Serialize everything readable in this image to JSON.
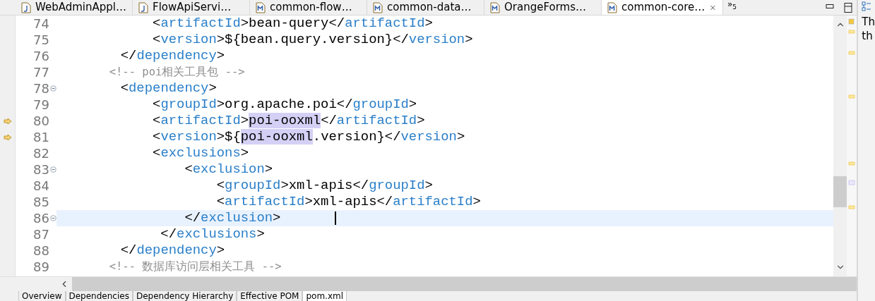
{
  "editor_tabs": [
    {
      "label": "WebAdminAppl…",
      "kind": "java",
      "selected": false
    },
    {
      "label": "FlowApiServi…",
      "kind": "java",
      "selected": false
    },
    {
      "label": "common-flow…",
      "kind": "maven",
      "selected": false
    },
    {
      "label": "common-data…",
      "kind": "maven",
      "selected": false
    },
    {
      "label": "OrangeForms…",
      "kind": "maven",
      "selected": false
    },
    {
      "label": "common-core…",
      "kind": "maven",
      "selected": true
    }
  ],
  "overflow": {
    "symbol": "»",
    "count": "5"
  },
  "code_lines": [
    {
      "number": "74",
      "fold": false,
      "marker": false,
      "current": false,
      "segs": [
        {
          "kind": "punct",
          "text": "            <"
        },
        {
          "kind": "name",
          "text": "artifactId"
        },
        {
          "kind": "punct",
          "text": ">"
        },
        {
          "kind": "text",
          "text": "bean-query",
          "highlighted": false
        },
        {
          "kind": "punct",
          "text": "</"
        },
        {
          "kind": "name",
          "text": "artifactId"
        },
        {
          "kind": "punct",
          "text": ">"
        }
      ]
    },
    {
      "number": "75",
      "fold": false,
      "marker": false,
      "current": false,
      "segs": [
        {
          "kind": "punct",
          "text": "            <"
        },
        {
          "kind": "name",
          "text": "version"
        },
        {
          "kind": "punct",
          "text": ">"
        },
        {
          "kind": "text",
          "text": "${bean.query.version}",
          "highlighted": false
        },
        {
          "kind": "punct",
          "text": "</"
        },
        {
          "kind": "name",
          "text": "version"
        },
        {
          "kind": "punct",
          "text": ">"
        }
      ]
    },
    {
      "number": "76",
      "fold": false,
      "marker": false,
      "current": false,
      "segs": [
        {
          "kind": "punct",
          "text": "        </"
        },
        {
          "kind": "name",
          "text": "dependency"
        },
        {
          "kind": "punct",
          "text": ">"
        }
      ]
    },
    {
      "number": "77",
      "fold": false,
      "marker": false,
      "current": false,
      "segs": [
        {
          "kind": "comment",
          "text": "        <!-- poi相关工具包 -->"
        }
      ]
    },
    {
      "number": "78",
      "fold": true,
      "marker": false,
      "current": false,
      "segs": [
        {
          "kind": "punct",
          "text": "        <"
        },
        {
          "kind": "name",
          "text": "dependency"
        },
        {
          "kind": "punct",
          "text": ">"
        }
      ]
    },
    {
      "number": "79",
      "fold": false,
      "marker": false,
      "current": false,
      "segs": [
        {
          "kind": "punct",
          "text": "            <"
        },
        {
          "kind": "name",
          "text": "groupId"
        },
        {
          "kind": "punct",
          "text": ">"
        },
        {
          "kind": "text",
          "text": "org.apache.poi",
          "highlighted": false
        },
        {
          "kind": "punct",
          "text": "</"
        },
        {
          "kind": "name",
          "text": "groupId"
        },
        {
          "kind": "punct",
          "text": ">"
        }
      ]
    },
    {
      "number": "80",
      "fold": false,
      "marker": true,
      "current": false,
      "segs": [
        {
          "kind": "punct",
          "text": "            <"
        },
        {
          "kind": "name",
          "text": "artifactId"
        },
        {
          "kind": "punct",
          "text": ">"
        },
        {
          "kind": "text",
          "text": "poi-ooxml",
          "highlighted": true
        },
        {
          "kind": "punct",
          "text": "</"
        },
        {
          "kind": "name",
          "text": "artifactId"
        },
        {
          "kind": "punct",
          "text": ">"
        }
      ]
    },
    {
      "number": "81",
      "fold": false,
      "marker": true,
      "current": false,
      "segs": [
        {
          "kind": "punct",
          "text": "            <"
        },
        {
          "kind": "name",
          "text": "version"
        },
        {
          "kind": "punct",
          "text": ">"
        },
        {
          "kind": "text",
          "text": "${",
          "highlighted": false
        },
        {
          "kind": "text",
          "text": "poi-ooxml",
          "highlighted": true
        },
        {
          "kind": "text",
          "text": ".version}",
          "highlighted": false
        },
        {
          "kind": "punct",
          "text": "</"
        },
        {
          "kind": "name",
          "text": "version"
        },
        {
          "kind": "punct",
          "text": ">"
        }
      ]
    },
    {
      "number": "82",
      "fold": false,
      "marker": false,
      "current": false,
      "segs": [
        {
          "kind": "punct",
          "text": "            <"
        },
        {
          "kind": "name",
          "text": "exclusions"
        },
        {
          "kind": "punct",
          "text": ">"
        }
      ]
    },
    {
      "number": "83",
      "fold": true,
      "marker": false,
      "current": false,
      "segs": [
        {
          "kind": "punct",
          "text": "                <"
        },
        {
          "kind": "name",
          "text": "exclusion"
        },
        {
          "kind": "punct",
          "text": ">"
        }
      ]
    },
    {
      "number": "84",
      "fold": false,
      "marker": false,
      "current": false,
      "segs": [
        {
          "kind": "punct",
          "text": "                    <"
        },
        {
          "kind": "name",
          "text": "groupId"
        },
        {
          "kind": "punct",
          "text": ">"
        },
        {
          "kind": "text",
          "text": "xml-apis",
          "highlighted": false
        },
        {
          "kind": "punct",
          "text": "</"
        },
        {
          "kind": "name",
          "text": "groupId"
        },
        {
          "kind": "punct",
          "text": ">"
        }
      ]
    },
    {
      "number": "85",
      "fold": false,
      "marker": false,
      "current": false,
      "segs": [
        {
          "kind": "punct",
          "text": "                    <"
        },
        {
          "kind": "name",
          "text": "artifactId"
        },
        {
          "kind": "punct",
          "text": ">"
        },
        {
          "kind": "text",
          "text": "xml-apis",
          "highlighted": false
        },
        {
          "kind": "punct",
          "text": "</"
        },
        {
          "kind": "name",
          "text": "artifactId"
        },
        {
          "kind": "punct",
          "text": ">"
        }
      ]
    },
    {
      "number": "86",
      "fold": true,
      "marker": false,
      "current": true,
      "segs": [
        {
          "kind": "punct",
          "text": "                </"
        },
        {
          "kind": "name",
          "text": "exclusion"
        },
        {
          "kind": "punct",
          "text": ">"
        }
      ]
    },
    {
      "number": "87",
      "fold": false,
      "marker": false,
      "current": false,
      "segs": [
        {
          "kind": "punct",
          "text": "             </"
        },
        {
          "kind": "name",
          "text": "exclusions"
        },
        {
          "kind": "punct",
          "text": ">"
        }
      ]
    },
    {
      "number": "88",
      "fold": false,
      "marker": false,
      "current": false,
      "segs": [
        {
          "kind": "punct",
          "text": "        </"
        },
        {
          "kind": "name",
          "text": "dependency"
        },
        {
          "kind": "punct",
          "text": ">"
        }
      ]
    },
    {
      "number": "89",
      "fold": false,
      "marker": false,
      "current": false,
      "segs": [
        {
          "kind": "comment",
          "text": "        <!-- 数据库访问层相关工具 -->"
        }
      ]
    }
  ],
  "side_panel": {
    "lines": [
      "Th",
      "th"
    ]
  },
  "page_tabs": [
    {
      "label": "Overview",
      "selected": false
    },
    {
      "label": "Dependencies",
      "selected": false
    },
    {
      "label": "Dependency Hierarchy",
      "selected": false
    },
    {
      "label": "Effective POM",
      "selected": false
    },
    {
      "label": "pom.xml",
      "selected": true
    }
  ]
}
